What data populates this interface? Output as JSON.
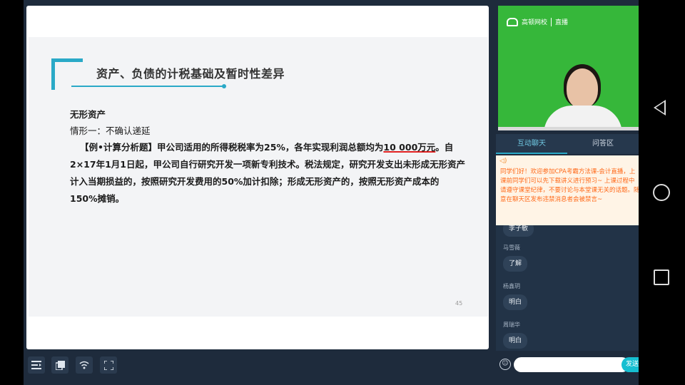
{
  "slide": {
    "title": "资产、负债的计税基础及暂时性差异",
    "subtitle": "无形资产",
    "case": "情形一：不确认递延",
    "para_before": "【例•计算分析题】甲公司适用的所得税税率为25%，各年实现利润总额均为",
    "para_emph": "10 000万元",
    "para_after": "。自2×17年1月1日起，甲公司自行研究开发一项新专利技术。税法规定，研究开发支出未形成无形资产计入当期损益的，按照研究开发费用的50%加计扣除；形成无形资产的，按照无形资产成本的150%摊销。",
    "page_number": "45"
  },
  "toolbar": {
    "icons": [
      "outline-icon",
      "copy-icon",
      "wifi-icon",
      "fullscreen-icon"
    ]
  },
  "video": {
    "logo_text": "高顿网校",
    "live_label": "直播"
  },
  "tabs": [
    "互动聊天",
    "问答区"
  ],
  "notice": {
    "text": "同学们好！欢迎参加CPA考霸方法课-会计直播，上课前同学们可以先下载讲义进行预习~ 上课过程中请遵守课堂纪律，不要讨论与本堂课无关的话题。随意在聊天区发布违禁消息者会被禁言~"
  },
  "chat": {
    "messages": [
      {
        "name": "",
        "text": "李子敏"
      },
      {
        "name": "马雪薇",
        "text": "了解"
      },
      {
        "name": "杨鑫玥",
        "text": "明白"
      },
      {
        "name": "周瑞华",
        "text": "明白"
      }
    ]
  },
  "input": {
    "placeholder": "",
    "send_label": "发送"
  },
  "colors": {
    "accent": "#2aa9c7",
    "notice_text": "#ff6a1a",
    "video_bg": "#36b73a"
  }
}
